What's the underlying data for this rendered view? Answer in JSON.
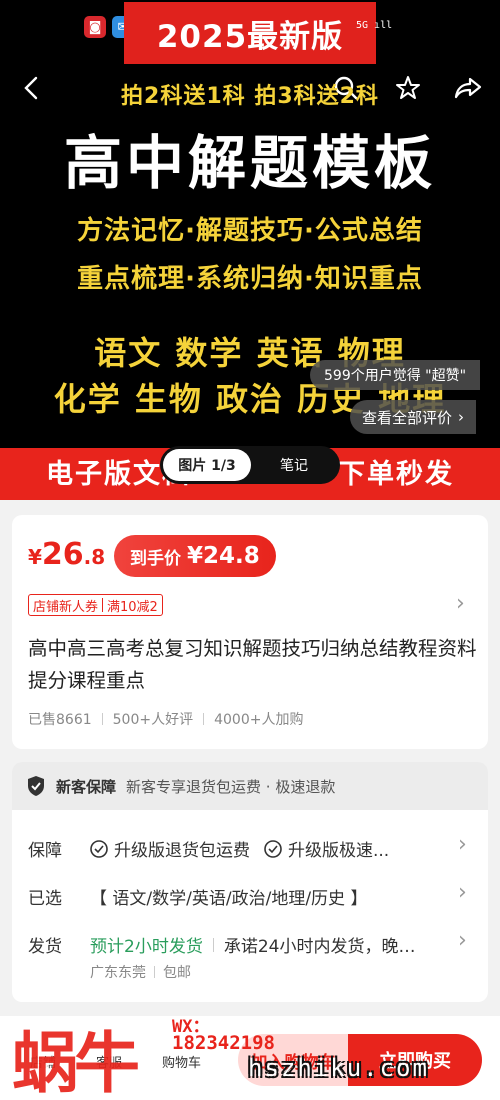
{
  "hero": {
    "year_badge": "2025最新版",
    "signal": "5G ıll",
    "promo": "拍2科送1科   拍3科送2科",
    "title": "高中解题模板",
    "features_1": "方法记忆·解题技巧·公式总结",
    "features_2": "重点梳理·系统归纳·知识重点",
    "subjects_1": "语文  数学  英语  物理",
    "subjects_2": "化学  生物  政治  历史  地理",
    "praise": "599个用户觉得 \"超赞\"",
    "all_reviews": "查看全部评价"
  },
  "strip": {
    "left_text": "电子版文档",
    "right_text": "下单秒发",
    "tabs": [
      {
        "label": "图片 1/3"
      },
      {
        "label": "笔记"
      }
    ]
  },
  "product": {
    "currency": "¥",
    "price_int": "26",
    "price_dec": ".8",
    "final_label": "到手价",
    "final_value": "¥24.8",
    "coupon_1": "店铺新人券",
    "coupon_2": "满10减2",
    "title": "高中高三高考总复习知识解题技巧归纳总结教程资料提分课程重点",
    "sold": "已售8661",
    "good_reviews": "500+人好评",
    "cart_adds": "4000+人加购"
  },
  "guarantee": {
    "header_title": "新客保障",
    "header_desc": "新客专享退货包运费 · 极速退款",
    "rows": [
      {
        "key": "保障",
        "item1": "升级版退货包运费",
        "item2": "升级版极速..."
      },
      {
        "key": "已选",
        "value": "【 语文/数学/英语/政治/地理/历史 】"
      },
      {
        "key": "发货",
        "highlight": "预计2小时发货",
        "value": "承诺24小时内发货，晚…"
      }
    ],
    "location": "广东东莞",
    "shipping": "包邮"
  },
  "bottom": {
    "store": "店铺",
    "service": "客服",
    "cart": "购物车",
    "add_to_cart": "加入购物车",
    "buy_now": "立即购买"
  },
  "watermark": {
    "logo": "蜗牛",
    "wx": "WX：",
    "number": "182342198",
    "site": "hszhiku.com"
  },
  "colors": {
    "accent": "#e8241c",
    "promo_yellow": "#f5d33a",
    "ship_green": "#2a9d5c"
  }
}
